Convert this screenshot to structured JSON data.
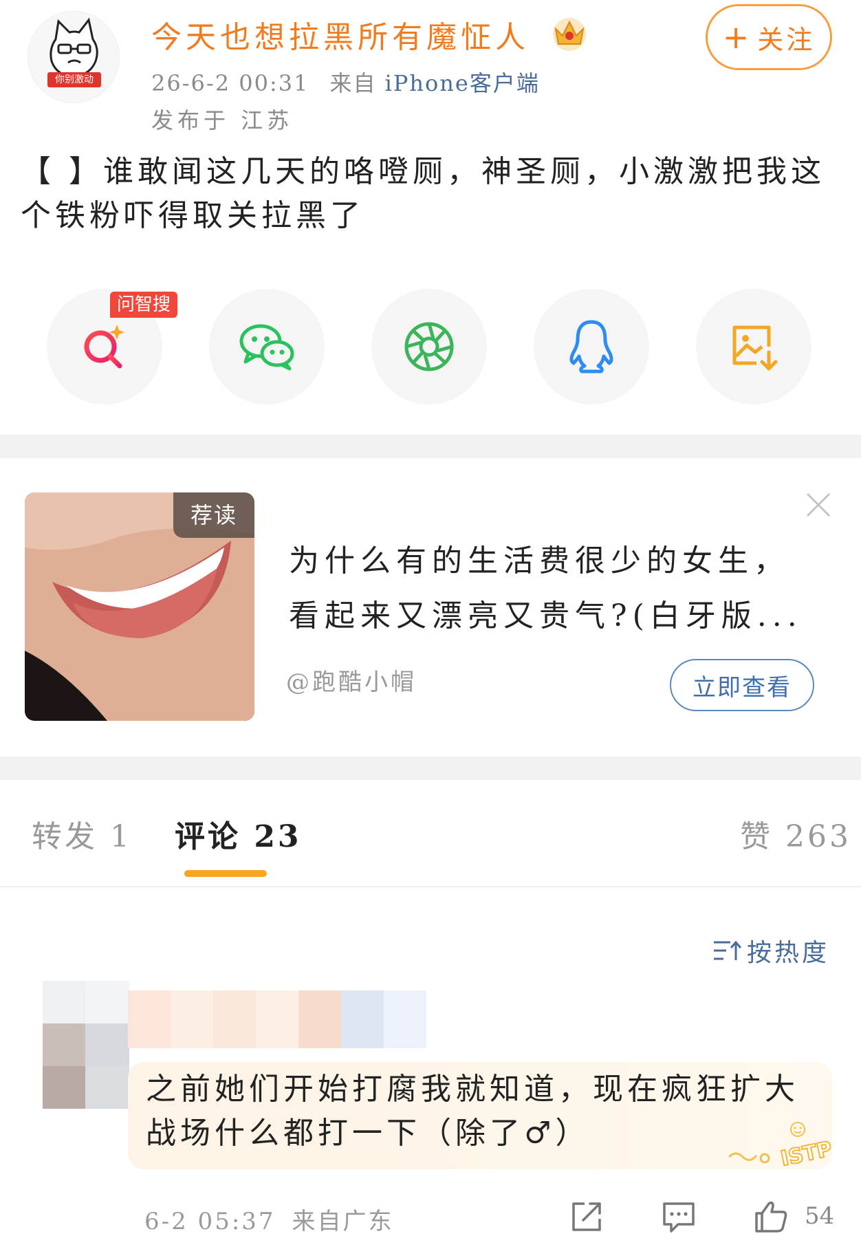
{
  "header": {
    "username": "今天也想拉黑所有魔怔人",
    "avatar_caption": "你别激动",
    "time": "26-6-2 00:31",
    "source_prefix": "来自",
    "source_client": "iPhone客户端",
    "location": "发布于 江苏",
    "follow_label": "关注",
    "brand_color": "#f27b1d"
  },
  "post": {
    "text": "【 】谁敢闻这几天的咯噔厕，神圣厕，小激激把我这个铁粉吓得取关拉黑了"
  },
  "share": {
    "badge": "问智搜",
    "icons": [
      "ai-search-icon",
      "wechat-icon",
      "moments-icon",
      "qq-icon",
      "save-image-icon"
    ]
  },
  "recommend": {
    "tag": "荐读",
    "title": "为什么有的生活费很少的女生，看起来又漂亮又贵气?(白牙版...",
    "author": "@跑酷小帽",
    "button": "立即查看"
  },
  "tabs": {
    "repost": "转发 1",
    "comments": "评论 23",
    "likes": "赞 263"
  },
  "sort_label": "按热度",
  "comment": {
    "text": "之前她们开始打腐我就知道，现在疯狂扩大战场什么都打一下（除了♂）",
    "sticker_text": "ISTP",
    "time": "6-2 05:37",
    "location": "来自广东",
    "like_count": "54"
  }
}
